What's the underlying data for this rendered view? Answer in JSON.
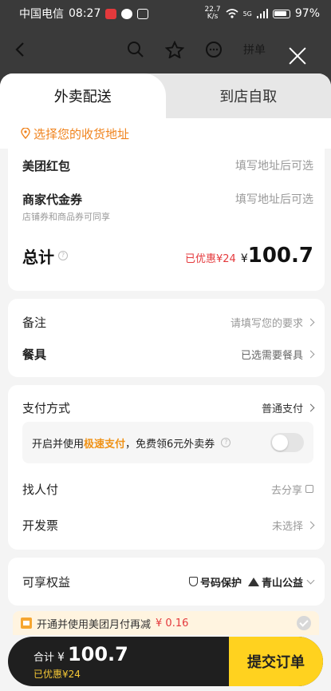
{
  "status_bar": {
    "carrier": "中国电信",
    "time": "08:27",
    "net_speed_value": "22.7",
    "net_speed_unit": "K/s",
    "signal": "5G",
    "battery": "97%"
  },
  "background_nav": {
    "back_icon": "chevron-left-icon",
    "search_icon": "search-icon",
    "favorite_icon": "star-icon",
    "message_icon": "chat-icon",
    "group_buy": "拼单"
  },
  "sheet": {
    "tabs": [
      {
        "label": "外卖配送",
        "active": true
      },
      {
        "label": "到店自取",
        "active": false
      }
    ],
    "address_prompt": "选择您的收货地址",
    "coupons": {
      "meituan_red_packet": {
        "label": "美团红包",
        "value": "填写地址后可选"
      },
      "merchant_voucher": {
        "label": "商家代金券",
        "value": "填写地址后可选",
        "note": "店铺券和商品券可同享"
      }
    },
    "total": {
      "label": "总计",
      "discount_text": "已优惠¥24",
      "currency": "¥",
      "amount": "100.7"
    },
    "remarks": {
      "label": "备注",
      "value": "请填写您的要求"
    },
    "cutlery": {
      "label": "餐具",
      "value": "已选需要餐具"
    },
    "payment": {
      "label": "支付方式",
      "value": "普通支付",
      "promo_prefix": "开启并使用",
      "promo_highlight": "极速支付",
      "promo_suffix": "，免费领6元外卖券",
      "toggle_on": false
    },
    "pay_for_me": {
      "label": "找人付",
      "value": "去分享"
    },
    "invoice": {
      "label": "开发票",
      "value": "未选择"
    },
    "benefits": {
      "label": "可享权益",
      "tag1": "号码保护",
      "tag2": "青山公益"
    },
    "monthly_pay": {
      "text": "开通并使用美团月付再减",
      "amount": "¥ 0.16"
    },
    "bottom": {
      "total_label": "合计",
      "currency": "¥",
      "amount": "100.7",
      "discount": "已优惠¥24",
      "submit": "提交订单"
    }
  },
  "colors": {
    "accent_orange": "#f0831d",
    "discount_red": "#e4393c",
    "submit_yellow": "#ffd21f",
    "bottom_bar_bg": "#1f1f1f"
  }
}
